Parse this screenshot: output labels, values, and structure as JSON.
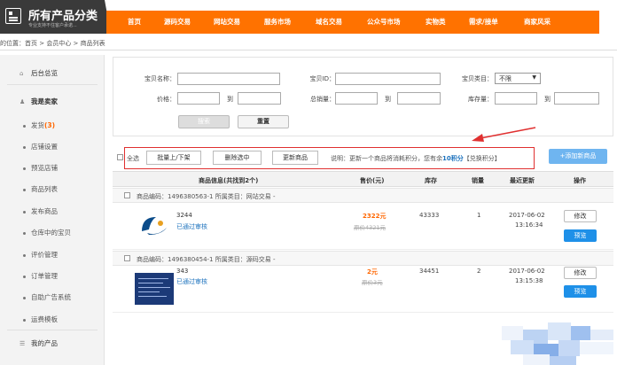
{
  "header": {
    "logo_title": "所有产品分类",
    "logo_subtitle": "专业支持不住客户承诺...",
    "nav": [
      "首页",
      "源码交易",
      "网站交易",
      "服务市场",
      "域名交易",
      "公众号市场",
      "实物类",
      "需求/接单",
      "商家风采"
    ]
  },
  "breadcrumb": "的位置：首页 > 会员中心 > 商品列表",
  "sidebar": {
    "dashboard": "后台总览",
    "seller_group": "我是卖家",
    "items": [
      {
        "label": "发货",
        "count": "(3)"
      },
      {
        "label": "店铺设置"
      },
      {
        "label": "预览店铺"
      },
      {
        "label": "商品列表"
      },
      {
        "label": "发布商品"
      },
      {
        "label": "仓库中的宝贝"
      },
      {
        "label": "评价管理"
      },
      {
        "label": "订单管理"
      },
      {
        "label": "自助广告系统"
      },
      {
        "label": "运费模板"
      }
    ],
    "my_products": "我的产品"
  },
  "search": {
    "name_label": "宝贝名称：",
    "id_label": "宝贝ID：",
    "category_label": "宝贝类目：",
    "category_value": "不限",
    "price_label": "价格：",
    "sales_label": "总销量：",
    "stock_label": "库存量：",
    "to": "到",
    "search_btn": "搜索",
    "reset_btn": "重置"
  },
  "actions": {
    "select_all": "全选",
    "batch_shelf": "批量上/下架",
    "delete_selected": "删除选中",
    "update_products": "更新商品",
    "note_prefix": "说明：更新一个商品将消耗积分，您有余",
    "note_points": "10积分",
    "note_suffix": "【兑换积分】",
    "add_product": "+添加新商品"
  },
  "table": {
    "headers": {
      "info": "商品信息(共找到2个)",
      "price": "售价(元)",
      "stock": "库存",
      "sales": "销量",
      "updated": "最近更新",
      "ops": "操作"
    },
    "rows": [
      {
        "group": "商品编码：1496380563-1   所属类目：网站交易 -",
        "name": "3244",
        "status": "已通过审核",
        "price": "2322元",
        "orig_price": "原价4321元",
        "stock": "43333",
        "sales": "1",
        "date": "2017-06-02",
        "time": "13:16:34",
        "edit": "修改",
        "preview": "预览"
      },
      {
        "group": "商品编码：1496380454-1   所属类目：源码交易 -",
        "name": "343",
        "status": "已通过审核",
        "price": "2元",
        "orig_price": "原价3元",
        "stock": "34451",
        "sales": "2",
        "date": "2017-06-02",
        "time": "13:15:38",
        "edit": "修改",
        "preview": "预览"
      }
    ]
  },
  "colors": {
    "nav_orange": "#ff7200",
    "price_orange": "#ff6600",
    "blue_button": "#1e90e8",
    "highlight_red": "#e03030"
  }
}
